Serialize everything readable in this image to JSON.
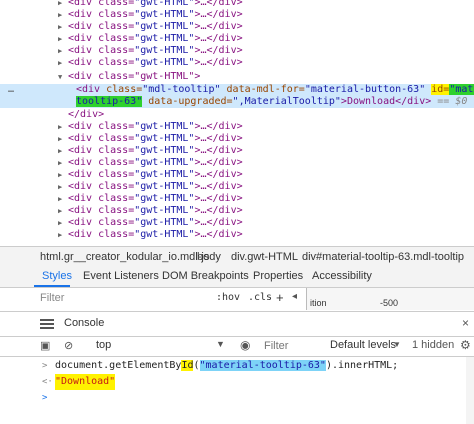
{
  "dom_tree": {
    "collapsed_tag_open": "<div class=",
    "collapsed_class_value": "\"gwt-HTML\"",
    "collapsed_tail": ">…</div>",
    "open_parent": "<div class=\"gwt-HTML\">",
    "selected": {
      "ellipsis": "…",
      "part1_tag": "<div ",
      "part1_attr": "class=",
      "part1_val": "\"mdl-tooltip\"",
      "part1_attr2": " data-mdl-for=",
      "part1_val2": "\"material-button-63\"",
      "id_attr": "id=",
      "id_val_a": "\"material-",
      "id_val_b": "tooltip-63\"",
      "part2_attr": " data-upgraded=",
      "part2_val": "\",MaterialTooltip\"",
      "part2_rest": ">Download</div>",
      "dollar": "== $0"
    },
    "close_div": "</div>"
  },
  "breadcrumb": {
    "items": [
      "html.gr__creator_kodular_io.mdl-js",
      "body",
      "div.gwt-HTML",
      "div#material-tooltip-63.mdl-tooltip"
    ]
  },
  "styles_tabs": {
    "items": [
      "Styles",
      "Event Listeners",
      "DOM Breakpoints",
      "Properties",
      "Accessibility"
    ]
  },
  "styles_filter": {
    "placeholder": "Filter",
    "hov": ":hov",
    "cls": ".cls",
    "plus": "+",
    "margin_label": "ition",
    "margin_value": "-500"
  },
  "console_drawer": {
    "tab_label": "Console",
    "close": "×"
  },
  "console_toolbar": {
    "context": "top",
    "filter_placeholder": "Filter",
    "levels": "Default levels",
    "hidden": "1 hidden"
  },
  "console_output": {
    "input_pre": "document.getElementBy",
    "input_id": "Id",
    "input_paren": "(",
    "input_str": "\"material-tooltip-63\"",
    "input_post": ").innerHTML;",
    "result": "\"Download\""
  },
  "colors": {
    "selection_bg": "#cfe8fc",
    "highlight_yellow": "#fff200",
    "highlight_green": "#2ed12e",
    "accent_blue": "#1a73e8"
  }
}
